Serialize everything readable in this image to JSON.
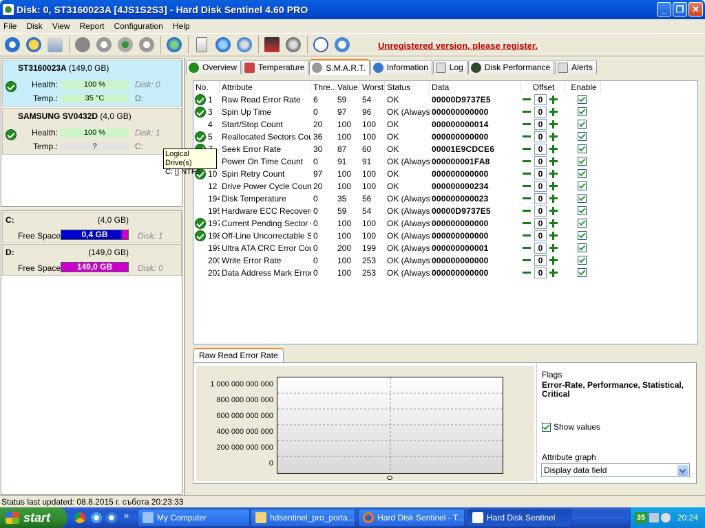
{
  "window": {
    "title": "Disk: 0, ST3160023A [4JS1S2S3]  -  Hard Disk Sentinel 4.60 PRO",
    "minimize": "_",
    "maximize": "❐",
    "close": "✕"
  },
  "menu": [
    "File",
    "Disk",
    "View",
    "Report",
    "Configuration",
    "Help"
  ],
  "toolbar": {
    "unregistered": "Unregistered version, please register."
  },
  "disks": [
    {
      "name": "ST3160023A",
      "size": "(149,0 GB)",
      "health_label": "Health:",
      "health": "100 %",
      "temp_label": "Temp.:",
      "temp": "35 °C",
      "disk_no": "Disk: 0",
      "drive": "D:"
    },
    {
      "name": "SAMSUNG SV0432D",
      "size": "(4,0 GB)",
      "health_label": "Health:",
      "health": "100 %",
      "temp_label": "Temp.:",
      "temp": "?",
      "disk_no": "Disk: 1",
      "drive": "C:"
    }
  ],
  "tooltip": {
    "line1": "Logical Drive(s)",
    "line2": "C: [] NTFS"
  },
  "volumes": [
    {
      "name": "C:",
      "size": "(4,0 GB)",
      "free_label": "Free Space",
      "free": "0,4 GB",
      "disk": "Disk: 1",
      "color": "#0000cc"
    },
    {
      "name": "D:",
      "size": "(149,0 GB)",
      "free_label": "Free Space",
      "free": "149,0 GB",
      "disk": "Disk: 0",
      "color": "#cc00cc"
    }
  ],
  "tabs": [
    "Overview",
    "Temperature",
    "S.M.A.R.T.",
    "Information",
    "Log",
    "Disk Performance",
    "Alerts"
  ],
  "smart": {
    "columns": [
      "No.",
      "Attribute",
      "Thre...",
      "Value",
      "Worst",
      "Status",
      "Data",
      "Offset",
      "Enable"
    ],
    "rows": [
      {
        "no": "1",
        "attr": "Raw Read Error Rate",
        "thr": "6",
        "val": "59",
        "worst": "54",
        "status": "OK",
        "data": "00000D9737E5",
        "offset": "0",
        "check": true
      },
      {
        "no": "3",
        "attr": "Spin Up Time",
        "thr": "0",
        "val": "97",
        "worst": "96",
        "status": "OK (Always...",
        "data": "000000000000",
        "offset": "0",
        "check": true
      },
      {
        "no": "4",
        "attr": "Start/Stop Count",
        "thr": "20",
        "val": "100",
        "worst": "100",
        "status": "OK",
        "data": "000000000014",
        "offset": "0",
        "check": false
      },
      {
        "no": "5",
        "attr": "Reallocated Sectors Count",
        "thr": "36",
        "val": "100",
        "worst": "100",
        "status": "OK",
        "data": "000000000000",
        "offset": "0",
        "check": true
      },
      {
        "no": "7",
        "attr": "Seek Error Rate",
        "thr": "30",
        "val": "87",
        "worst": "60",
        "status": "OK",
        "data": "00001E9CDCE6",
        "offset": "0",
        "check": true
      },
      {
        "no": "9",
        "attr": "Power On Time Count",
        "thr": "0",
        "val": "91",
        "worst": "91",
        "status": "OK (Always...",
        "data": "000000001FA8",
        "offset": "0",
        "check": false
      },
      {
        "no": "10",
        "attr": "Spin Retry Count",
        "thr": "97",
        "val": "100",
        "worst": "100",
        "status": "OK",
        "data": "000000000000",
        "offset": "0",
        "check": true
      },
      {
        "no": "12",
        "attr": "Drive Power Cycle Count",
        "thr": "20",
        "val": "100",
        "worst": "100",
        "status": "OK",
        "data": "000000000234",
        "offset": "0",
        "check": false
      },
      {
        "no": "194",
        "attr": "Disk Temperature",
        "thr": "0",
        "val": "35",
        "worst": "56",
        "status": "OK (Always...",
        "data": "000000000023",
        "offset": "0",
        "check": false
      },
      {
        "no": "195",
        "attr": "Hardware ECC Recovered",
        "thr": "0",
        "val": "59",
        "worst": "54",
        "status": "OK (Always...",
        "data": "00000D9737E5",
        "offset": "0",
        "check": false
      },
      {
        "no": "197",
        "attr": "Current Pending Sector C...",
        "thr": "0",
        "val": "100",
        "worst": "100",
        "status": "OK (Always...",
        "data": "000000000000",
        "offset": "0",
        "check": true
      },
      {
        "no": "198",
        "attr": "Off-Line Uncorrectable S...",
        "thr": "0",
        "val": "100",
        "worst": "100",
        "status": "OK (Always...",
        "data": "000000000000",
        "offset": "0",
        "check": true
      },
      {
        "no": "199",
        "attr": "Ultra ATA CRC Error Count",
        "thr": "0",
        "val": "200",
        "worst": "199",
        "status": "OK (Always...",
        "data": "000000000001",
        "offset": "0",
        "check": false
      },
      {
        "no": "200",
        "attr": "Write Error Rate",
        "thr": "0",
        "val": "100",
        "worst": "253",
        "status": "OK (Always...",
        "data": "000000000000",
        "offset": "0",
        "check": false
      },
      {
        "no": "202",
        "attr": "Data Address Mark Errors",
        "thr": "0",
        "val": "100",
        "worst": "253",
        "status": "OK (Always...",
        "data": "000000000000",
        "offset": "0",
        "check": false
      }
    ]
  },
  "graph": {
    "tab": "Raw Read Error Rate",
    "yticks": [
      "1 000 000 000 000",
      "800 000 000 000",
      "600 000 000 000",
      "400 000 000 000",
      "200 000 000 000",
      "0"
    ],
    "flags_label": "Flags",
    "flags": "Error-Rate, Performance, Statistical, Critical",
    "show_values": "Show values",
    "attr_graph_label": "Attribute graph",
    "attr_graph_value": "Display data field"
  },
  "status": "Status last updated: 08.8.2015 г. събота 20:23:33",
  "taskbar": {
    "start": "start",
    "more": "»",
    "tasks": [
      "My Computer",
      "hdsentinel_pro_porta...",
      "Hard Disk Sentinel - T...",
      "Hard Disk Sentinel"
    ],
    "tray_temp": "35",
    "clock": "20:24"
  }
}
